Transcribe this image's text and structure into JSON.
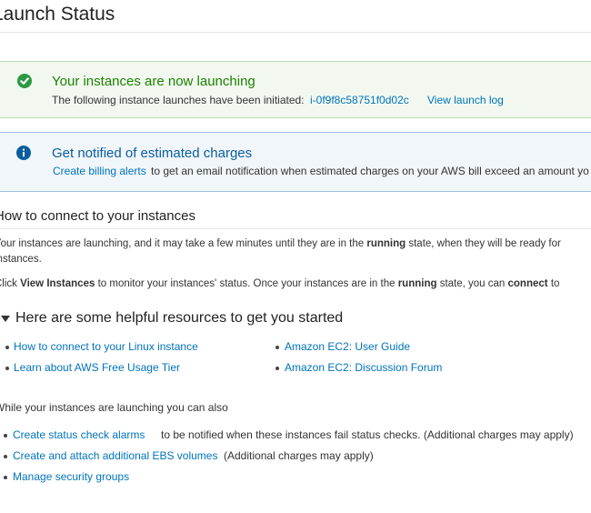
{
  "page_title": "Launch Status",
  "success_box": {
    "title": "Your instances are now launching",
    "text": "The following instance launches have been initiated:",
    "instance_id": "i-0f9f8c58751f0d02c",
    "view_log": "View launch log"
  },
  "info_box": {
    "title": "Get notified of estimated charges",
    "link": "Create billing alerts",
    "text": "to get an email notification when estimated charges on your AWS bill exceed an amount yo"
  },
  "connect": {
    "heading": "How to connect to your instances",
    "p1_a": "Your instances are launching, and it may take a few minutes until they are in the",
    "p1_bold": "running",
    "p1_b": "state, when they will be ready for",
    "p1_line2": "instances.",
    "p2_a": "Click",
    "p2_bold1": "View Instances",
    "p2_b": "to monitor your instances' status. Once your instances are in the",
    "p2_bold2": "running",
    "p2_c": "state, you can",
    "p2_bold3": "connect",
    "p2_d": "to"
  },
  "resources": {
    "heading": "Here are some helpful resources to get you started",
    "links_left": [
      "How to connect to your Linux instance",
      "Learn about AWS Free Usage Tier"
    ],
    "links_right": [
      "Amazon EC2: User Guide",
      "Amazon EC2: Discussion Forum"
    ]
  },
  "while_launching": {
    "heading": "While your instances are launching you can also",
    "items": [
      {
        "link": "Create status check alarms",
        "text": "to be notified when these instances fail status checks. (Additional charges may apply)"
      },
      {
        "link": "Create and attach additional EBS volumes",
        "text": "(Additional charges may apply)"
      },
      {
        "link": "Manage security groups",
        "text": ""
      }
    ]
  },
  "colors": {
    "success": "#1d8102",
    "info": "#0a5d9e",
    "link": "#0073bb"
  }
}
